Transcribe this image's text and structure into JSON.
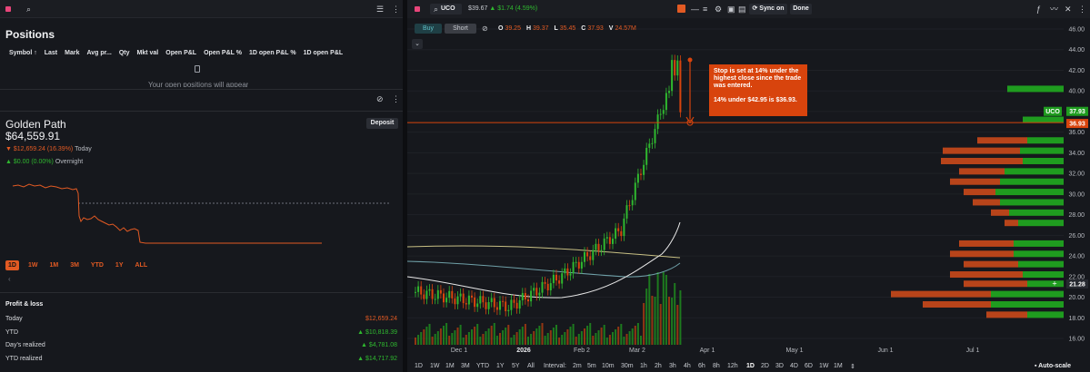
{
  "left_panel": {
    "title": "Positions",
    "columns": [
      "Symbol ↑",
      "Last",
      "Mark",
      "Avg pr...",
      "Qty",
      "Mkt val",
      "Open P&L",
      "Open P&L %",
      "1D open P&L %",
      "1D open P&L"
    ],
    "empty_text": "Your open positions will appear",
    "account_name": "Golden Path",
    "account_value": "$64,559.91",
    "today_change": "▼ $12,659.24 (16.39%)",
    "today_label": "Today",
    "overnight_change": "▲ $0.00 (0.00%)",
    "overnight_label": "Overnight",
    "deposit_label": "Deposit",
    "ranges": [
      "1D",
      "1W",
      "1M",
      "3M",
      "YTD",
      "1Y",
      "ALL"
    ],
    "active_range": "1D",
    "pl_title": "Profit & loss",
    "pl_rows": [
      {
        "label": "Today",
        "value": "$12,659.24",
        "dir": "red"
      },
      {
        "label": "YTD",
        "value": "▲ $10,818.39",
        "dir": "green"
      },
      {
        "label": "Day's realized",
        "value": "▲ $4,781.08",
        "dir": "green"
      },
      {
        "label": "YTD realized",
        "value": "▲ $14,717.92",
        "dir": "green"
      }
    ]
  },
  "right_panel": {
    "ticker": "UCO",
    "price": "$39.67",
    "change": "▲ $1.74 (4.59%)",
    "sync_label": "Sync on",
    "done_label": "Done",
    "buy_label": "Buy",
    "short_label": "Short",
    "ohlc": {
      "o": "39.25",
      "h": "39.37",
      "l": "35.45",
      "c": "37.93",
      "v": "24.57M"
    },
    "annotation_line1": "Stop is set at 14% under the highest close since the trade was entered.",
    "annotation_line2": "14% under $42.95 is $36.93.",
    "last_price_tag": "37.93",
    "stop_price_tag": "36.93",
    "ticker_tag": "UCO",
    "poc_tag": "21.28",
    "y_ticks": [
      "46.00",
      "44.00",
      "42.00",
      "40.00",
      "38.00",
      "36.00",
      "34.00",
      "32.00",
      "30.00",
      "28.00",
      "26.00",
      "24.00",
      "22.00",
      "20.00",
      "18.00",
      "16.00"
    ],
    "x_ticks": [
      "Dec 1",
      "2026",
      "Feb 2",
      "Mar 2",
      "Apr 1",
      "May 1",
      "Jun 1",
      "Jul 1"
    ],
    "periods": [
      "1D",
      "1W",
      "1M",
      "3M",
      "YTD",
      "1Y",
      "5Y",
      "All"
    ],
    "interval_label": "Interval:",
    "intervals": [
      "2m",
      "5m",
      "10m",
      "30m",
      "1h",
      "2h",
      "3h",
      "4h",
      "6h",
      "8h",
      "12h",
      "1D",
      "2D",
      "3D",
      "4D",
      "6D",
      "1W",
      "1M"
    ],
    "active_interval": "1D",
    "autoscale_label": "Auto-scale"
  },
  "colors": {
    "accent": "#e25a23",
    "up": "#2fb82f",
    "down": "#d8440d",
    "annotation": "#d8440d"
  }
}
